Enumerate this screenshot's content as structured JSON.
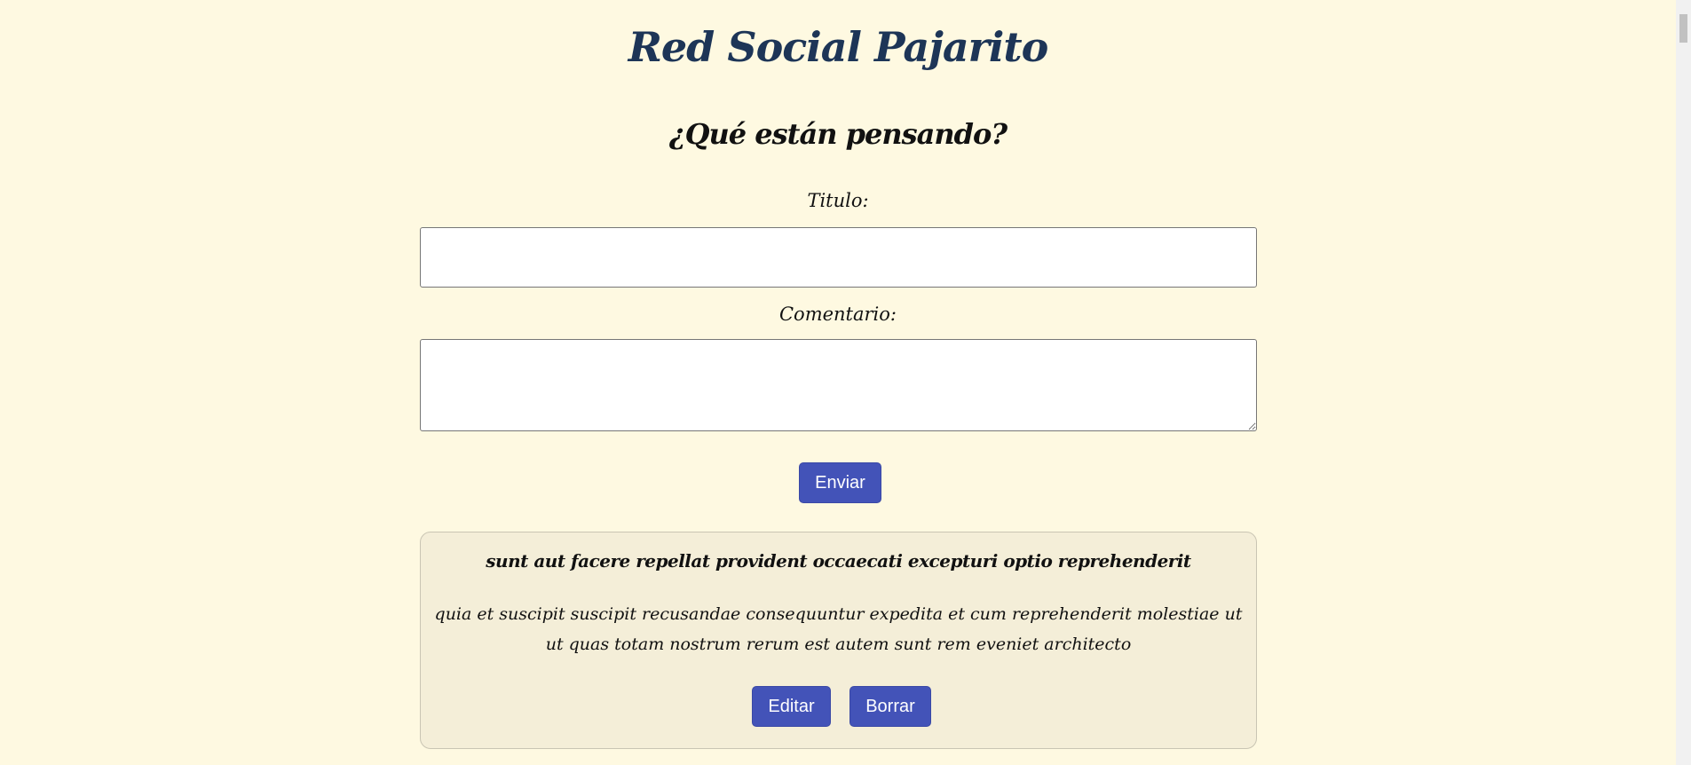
{
  "header": {
    "site_title": "Red Social Pajarito",
    "subtitle": "¿Qué están pensando?"
  },
  "form": {
    "title_label": "Titulo:",
    "title_value": "",
    "comment_label": "Comentario:",
    "comment_value": "",
    "submit_label": "Enviar"
  },
  "posts": [
    {
      "title": "sunt aut facere repellat provident occaecati excepturi optio reprehenderit",
      "body": "quia et suscipit suscipit recusandae consequuntur expedita et cum reprehenderit molestiae ut ut quas totam nostrum rerum est autem sunt rem eveniet architecto",
      "edit_label": "Editar",
      "delete_label": "Borrar"
    }
  ],
  "colors": {
    "background": "#fef9e1",
    "title": "#1d3557",
    "button": "#4353b8",
    "card": "#f4eed8"
  }
}
